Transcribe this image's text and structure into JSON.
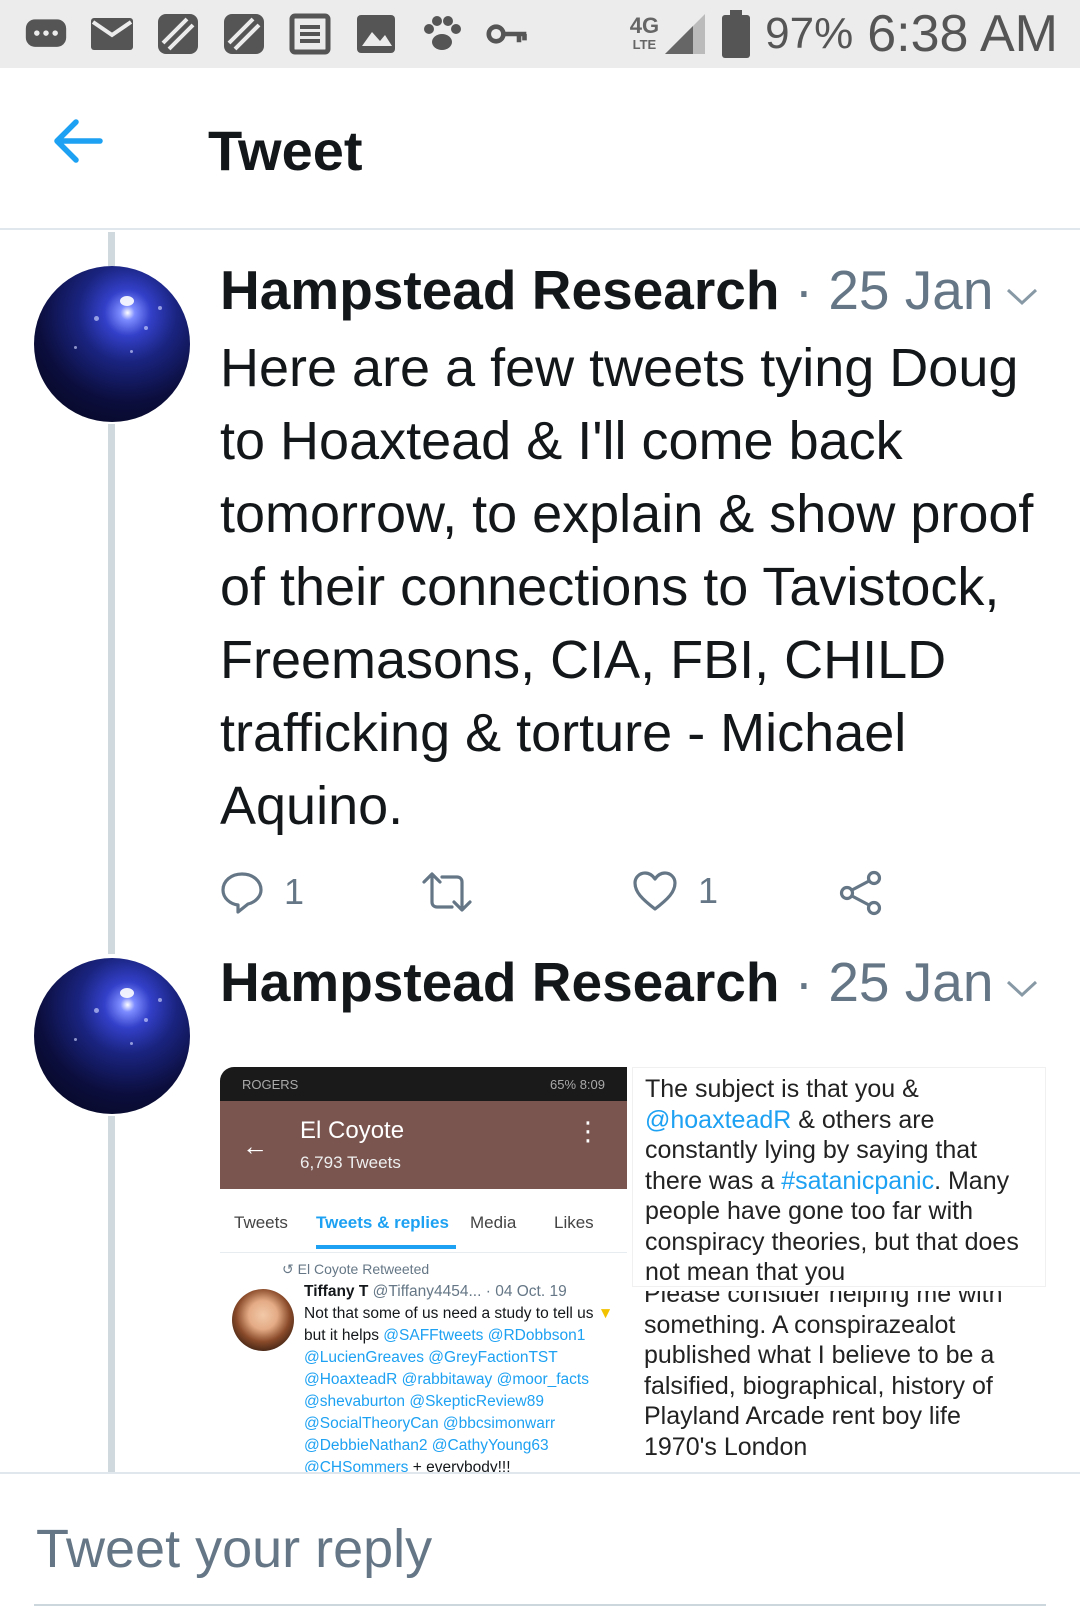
{
  "status_bar": {
    "network": "4G",
    "network_sub": "LTE",
    "battery": "97%",
    "time": "6:38 AM",
    "icons": [
      "messaging-icon",
      "email-icon",
      "blackberry-icon",
      "blackberry-icon",
      "news-icon",
      "gallery-icon",
      "paw-icon",
      "key-icon",
      "signal-icon",
      "battery-icon"
    ]
  },
  "header": {
    "title": "Tweet"
  },
  "tweets": [
    {
      "author": "Hampstead Research",
      "separator": "·",
      "date": "25 Jan",
      "text": "Here are a few tweets tying Doug to Hoaxtead & I'll come back tomorrow, to explain & show proof of their connections to Tavistock, Freemasons, CIA, FBI, CHILD trafficking & torture - Michael Aquino.",
      "reply_count": "1",
      "like_count": "1"
    },
    {
      "author": "Hampstead Research",
      "separator": "·",
      "date": "25 Jan"
    }
  ],
  "media_left": {
    "carrier": "ROGERS",
    "battery": "65%",
    "time": "8:09",
    "profile_name": "El Coyote",
    "tweet_count": "6,793 Tweets",
    "tabs": [
      "Tweets",
      "Tweets & replies",
      "Media",
      "Likes"
    ],
    "retweet_label": "El Coyote Retweeted",
    "embedded_name": "Tiffany T",
    "embedded_handle": "@Tiffany4454...",
    "embedded_date": "· 04 Oct. 19",
    "embedded_text": "Not that some of us need a study to tell us",
    "embedded_text2": "but it helps",
    "mentions": "@SAFFtweets @RDobbson1 @LucienGreaves @GreyFactionTST @HoaxteadR @rabbitaway @moor_facts @shevaburton @SkepticReview89 @SocialTheoryCan @bbcsimonwarr @DebbieNathan2 @CathyYoung63 @CHSommers",
    "embedded_tail": "+ everybody!!!"
  },
  "media_right_top": {
    "line_a": "The subject is that you &",
    "mention": "@hoaxteadR",
    "line_b": "& others are constantly lying by saying that there was a",
    "hashtag": "#satanicpanic",
    "line_c": ". Many people have gone too far with conspiracy theories, but that does not mean that you"
  },
  "media_right_bottom": {
    "text": "Please consider helping me with something. A conspirazealot published what I believe to be a falsified, biographical, history of Playland Arcade rent boy life 1970's London"
  },
  "reply_bar": {
    "placeholder": "Tweet your reply"
  },
  "colors": {
    "accent": "#1da1f2",
    "secondary_text": "#657786",
    "thread_line": "#cfd9de"
  }
}
